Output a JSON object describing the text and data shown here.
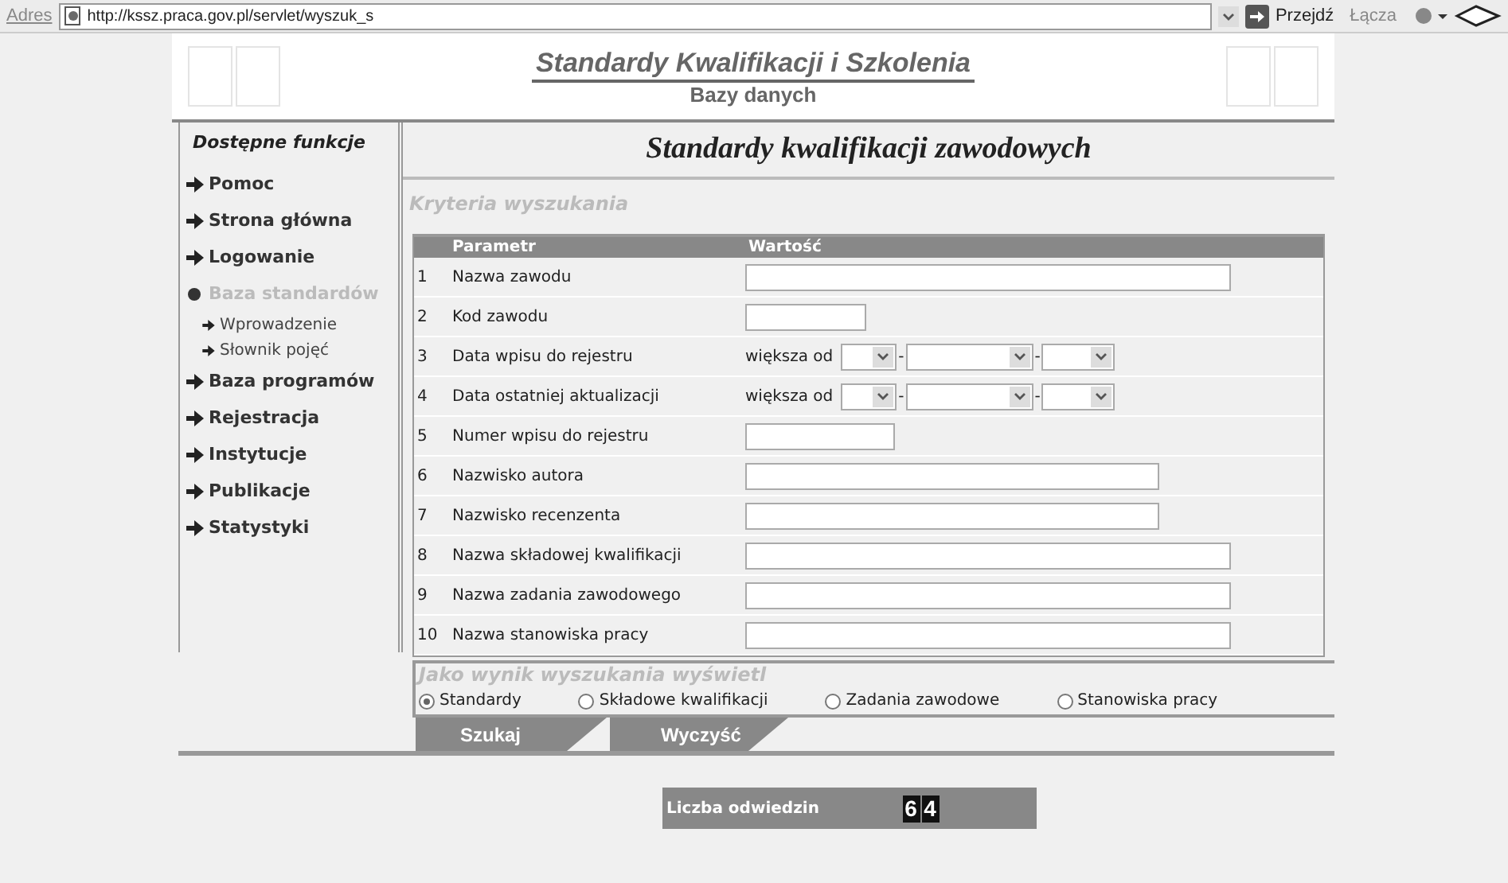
{
  "address_bar": {
    "label": "Adres",
    "url": "http://kssz.praca.gov.pl/servlet/wyszuk_s",
    "go_button": "Przejdź",
    "links": "Łącza"
  },
  "header": {
    "title": "Standardy Kwalifikacji i Szkolenia",
    "subtitle": "Bazy danych"
  },
  "sidebar": {
    "title": "Dostępne funkcje",
    "items": [
      {
        "label": "Pomoc",
        "selected": false
      },
      {
        "label": "Strona główna",
        "selected": false
      },
      {
        "label": "Logowanie",
        "selected": false
      },
      {
        "label": "Baza standardów",
        "selected": true,
        "children": [
          {
            "label": "Wprowadzenie"
          },
          {
            "label": "Słownik pojęć"
          }
        ]
      },
      {
        "label": "Baza programów",
        "selected": false
      },
      {
        "label": "Rejestracja",
        "selected": false
      },
      {
        "label": "Instytucje",
        "selected": false
      },
      {
        "label": "Publikacje",
        "selected": false
      },
      {
        "label": "Statystyki",
        "selected": false
      }
    ]
  },
  "main": {
    "title": "Standardy kwalifikacji zawodowych",
    "criteria_heading": "Kryteria wyszukania",
    "table": {
      "columns": [
        "Parametr",
        "Wartość"
      ],
      "rows": [
        {
          "number": "1",
          "label": "Nazwa zawodu",
          "kind": "long"
        },
        {
          "number": "2",
          "label": "Kod zawodu",
          "kind": "short"
        },
        {
          "number": "3",
          "label": "Data wpisu do rejestru",
          "kind": "date",
          "prefix": "większa od",
          "separator": "-"
        },
        {
          "number": "4",
          "label": "Data ostatniej aktualizacji",
          "kind": "date",
          "prefix": "większa od",
          "separator": "-"
        },
        {
          "number": "5",
          "label": "Numer wpisu do rejestru",
          "kind": "medium"
        },
        {
          "number": "6",
          "label": "Nazwisko autora",
          "kind": "wide"
        },
        {
          "number": "7",
          "label": "Nazwisko recenzenta",
          "kind": "wide"
        },
        {
          "number": "8",
          "label": "Nazwa składowej kwalifikacji",
          "kind": "long"
        },
        {
          "number": "9",
          "label": "Nazwa zadania zawodowego",
          "kind": "long"
        },
        {
          "number": "10",
          "label": "Nazwa stanowiska pracy",
          "kind": "long"
        }
      ]
    },
    "result_heading": "Jako wynik wyszukania wyświetl",
    "result_options": [
      {
        "label": "Standardy",
        "selected": true
      },
      {
        "label": "Składowe kwalifikacji",
        "selected": false
      },
      {
        "label": "Zadania zawodowe",
        "selected": false
      },
      {
        "label": "Stanowiska pracy",
        "selected": false
      }
    ],
    "buttons": [
      "Szukaj",
      "Wyczyść"
    ]
  },
  "counter": {
    "label": "Liczba odwiedzin",
    "digits": [
      "6",
      "4"
    ]
  }
}
